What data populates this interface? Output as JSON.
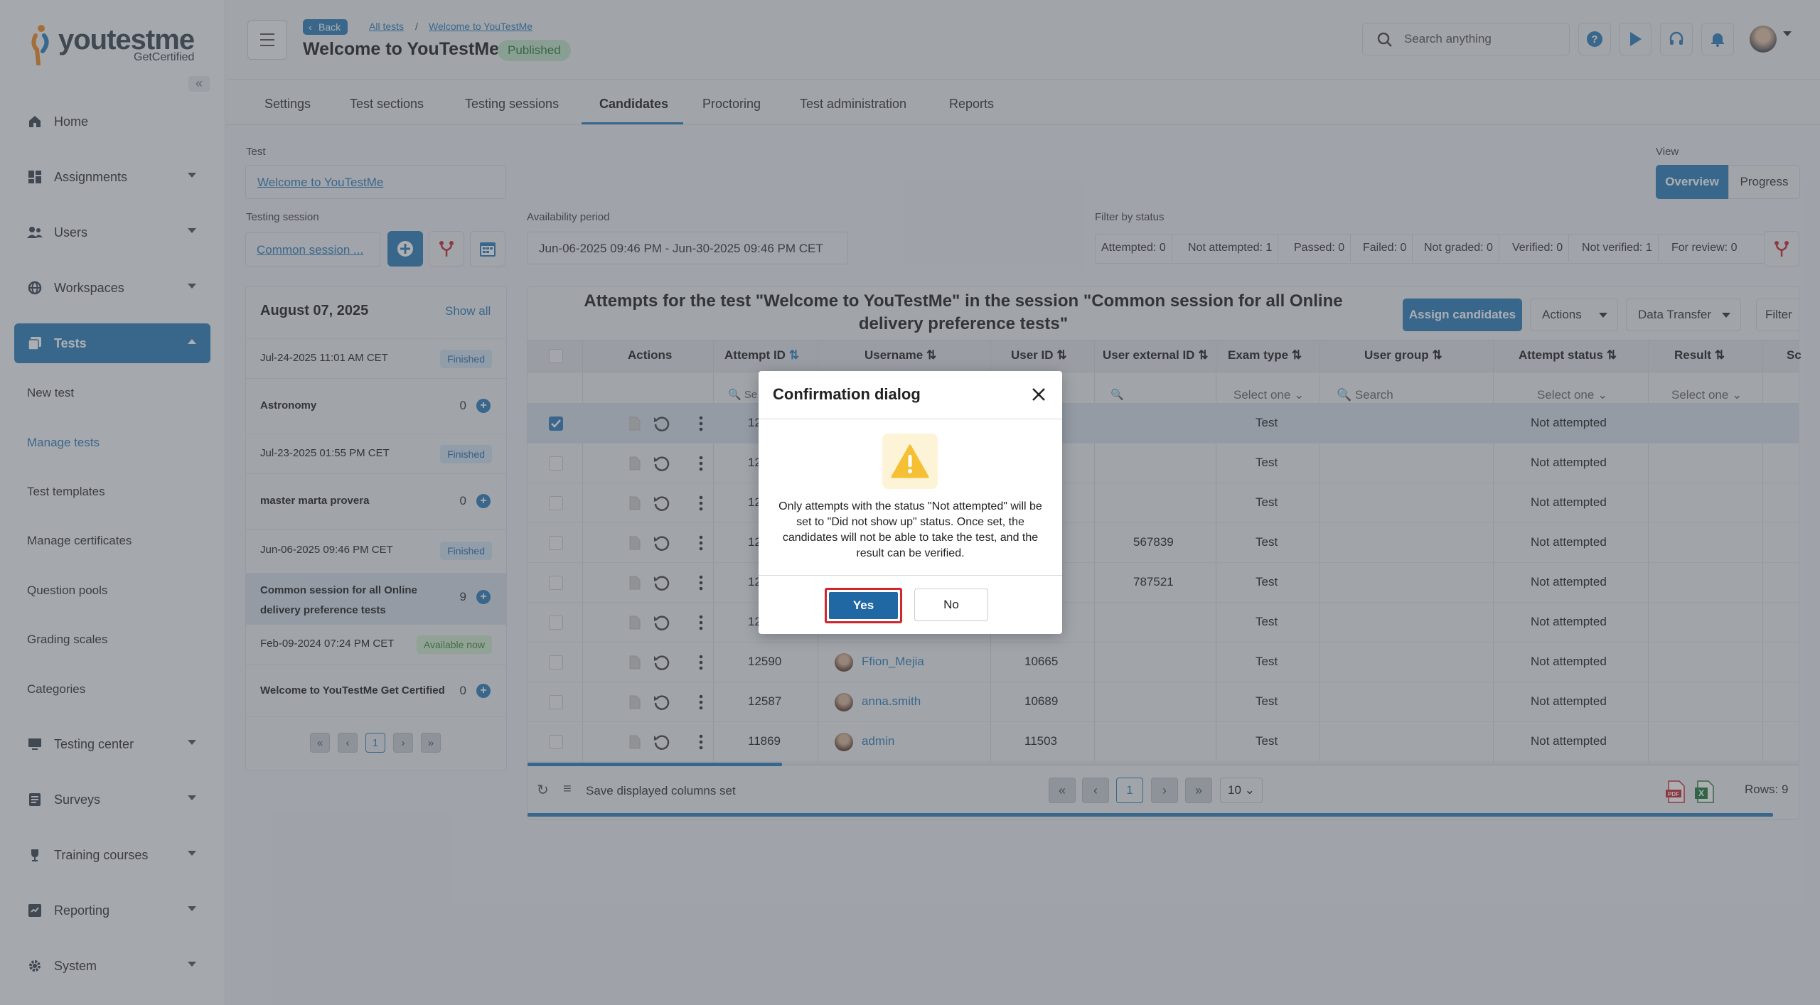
{
  "brand": {
    "name": "youtestme",
    "tagline": "GetCertified"
  },
  "sidebar": {
    "items": [
      {
        "label": "Home"
      },
      {
        "label": "Assignments"
      },
      {
        "label": "Users"
      },
      {
        "label": "Workspaces"
      },
      {
        "label": "Tests"
      },
      {
        "label": "Testing center"
      },
      {
        "label": "Surveys"
      },
      {
        "label": "Training courses"
      },
      {
        "label": "Reporting"
      },
      {
        "label": "System"
      }
    ],
    "tests_sub": [
      {
        "label": "New test"
      },
      {
        "label": "Manage tests"
      },
      {
        "label": "Test templates"
      },
      {
        "label": "Manage certificates"
      },
      {
        "label": "Question pools"
      },
      {
        "label": "Grading scales"
      },
      {
        "label": "Categories"
      }
    ]
  },
  "header": {
    "back_label": "Back",
    "breadcrumb": [
      "All tests",
      "Welcome to YouTestMe"
    ],
    "breadcrumb_sep": "/",
    "title": "Welcome to YouTestMe",
    "status_badge": "Published",
    "search_placeholder": "Search anything"
  },
  "tabs": [
    "Settings",
    "Test sections",
    "Testing sessions",
    "Candidates",
    "Proctoring",
    "Test administration",
    "Reports"
  ],
  "filters": {
    "test_label": "Test",
    "test_value": "Welcome to YouTestMe",
    "session_label": "Testing session",
    "session_value": "Common session ...",
    "availability_label": "Availability period",
    "availability_value": "Jun-06-2025 09:46 PM - Jun-30-2025 09:46 PM CET",
    "status_label": "Filter by status",
    "statuses": [
      "Attempted: 0",
      "Not attempted: 1",
      "Passed: 0",
      "Failed: 0",
      "Not graded: 0",
      "Verified: 0",
      "Not verified: 1",
      "For review: 0"
    ],
    "view_label": "View",
    "view_options": [
      "Overview",
      "Progress"
    ]
  },
  "sessions_panel": {
    "date": "August 07, 2025",
    "show_all": "Show all",
    "items": [
      {
        "when": "Jul-24-2025 11:01 AM CET",
        "badge": "Finished",
        "name": "Astronomy",
        "count": "0"
      },
      {
        "when": "Jul-23-2025 01:55 PM CET",
        "badge": "Finished",
        "name": "master marta provera",
        "count": "0"
      },
      {
        "when": "Jun-06-2025 09:46 PM CET",
        "badge": "Finished",
        "name": "Common session for all Online delivery preference tests",
        "count": "9"
      },
      {
        "when": "Feb-09-2024 07:24 PM CET",
        "badge": "Available now",
        "name": "Welcome to YouTestMe Get Certified",
        "count": "0"
      }
    ],
    "page": "1"
  },
  "table": {
    "title": "Attempts for the test \"Welcome to YouTestMe\" in the session \"Common session for all Online delivery preference tests\"",
    "buttons": {
      "assign": "Assign candidates",
      "actions": "Actions",
      "data_transfer": "Data Transfer",
      "filter": "Filter"
    },
    "columns": [
      "Actions",
      "Attempt ID",
      "Username",
      "User ID",
      "User external ID",
      "Exam type",
      "User group",
      "Attempt status",
      "Result",
      "Sc"
    ],
    "filter_placeholders": {
      "attempt": "Se",
      "group": "Search",
      "select": "Select one"
    },
    "rows": [
      {
        "attempt": "12",
        "username": "",
        "user_id": "",
        "ext": "",
        "exam": "Test",
        "status": "Not attempted",
        "checked": true
      },
      {
        "attempt": "12",
        "username": "",
        "user_id": "",
        "ext": "",
        "exam": "Test",
        "status": "Not attempted",
        "checked": false
      },
      {
        "attempt": "12",
        "username": "",
        "user_id": "",
        "ext": "",
        "exam": "Test",
        "status": "Not attempted",
        "checked": false
      },
      {
        "attempt": "12",
        "username": "",
        "user_id": "",
        "ext": "567839",
        "exam": "Test",
        "status": "Not attempted",
        "checked": false
      },
      {
        "attempt": "12",
        "username": "",
        "user_id": "",
        "ext": "787521",
        "exam": "Test",
        "status": "Not attempted",
        "checked": false
      },
      {
        "attempt": "12",
        "username": "",
        "user_id": "",
        "ext": "",
        "exam": "Test",
        "status": "Not attempted",
        "checked": false
      },
      {
        "attempt": "12590",
        "username": "Ffion_Mejia",
        "user_id": "10665",
        "ext": "",
        "exam": "Test",
        "status": "Not attempted",
        "checked": false
      },
      {
        "attempt": "12587",
        "username": "anna.smith",
        "user_id": "10689",
        "ext": "",
        "exam": "Test",
        "status": "Not attempted",
        "checked": false
      },
      {
        "attempt": "11869",
        "username": "admin",
        "user_id": "11503",
        "ext": "",
        "exam": "Test",
        "status": "Not attempted",
        "checked": false
      }
    ],
    "footer": {
      "save_columns": "Save displayed columns set",
      "page": "1",
      "page_size": "10",
      "rows": "Rows: 9"
    }
  },
  "dialog": {
    "title": "Confirmation dialog",
    "message": "Only attempts with the status \"Not attempted\" will be set to \"Did not show up\" status. Once set, the candidates will not be able to take the test, and the result can be verified.",
    "yes": "Yes",
    "no": "No"
  },
  "colors": {
    "accent": "#2e7fb8",
    "published": "#bfe4c6",
    "highlight_border": "#d0262c",
    "warning": "#f5c033"
  }
}
